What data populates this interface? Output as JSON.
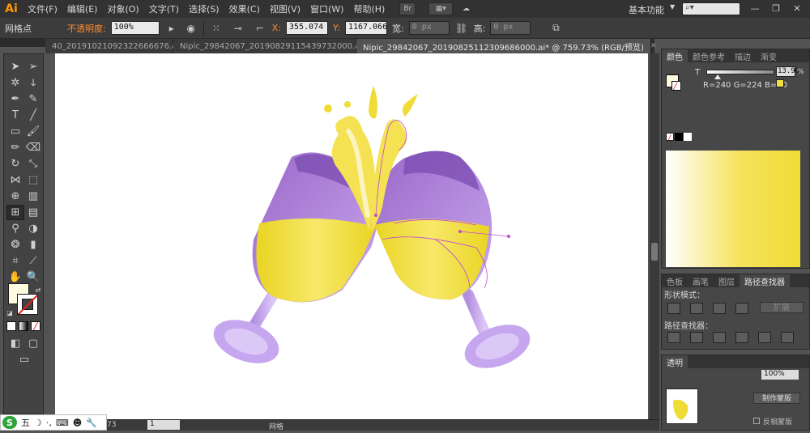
{
  "app": {
    "logo": "Ai"
  },
  "menu": [
    "文件(F)",
    "编辑(E)",
    "对象(O)",
    "文字(T)",
    "选择(S)",
    "效果(C)",
    "视图(V)",
    "窗口(W)",
    "帮助(H)"
  ],
  "menubar": {
    "br_label": "Br",
    "workspace": "基本功能"
  },
  "controlbar": {
    "tool_name": "网格点",
    "opacity_label": "不透明度:",
    "opacity_value": "100%",
    "x_label": "X:",
    "x_value": "355.074 p",
    "y_label": "Y:",
    "y_value": "1167.066",
    "w_label": "宽:",
    "w_value": "0 px",
    "h_label": "高:",
    "h_value": "0 px"
  },
  "tabs": [
    {
      "label": "40_20191021092322666676.ai*",
      "active": false
    },
    {
      "label": "Nipic_29842067_20190829115439732000.ai*",
      "active": false
    },
    {
      "label": "Nipic_29842067_20190825112309686000.ai* @ 759.73% (RGB/预览)",
      "active": true
    }
  ],
  "statusbar": {
    "zoom": "73",
    "page": "1",
    "mode": "网格"
  },
  "ime": {
    "logo": "S",
    "label": "五"
  },
  "color_panel": {
    "tabs": [
      "颜色",
      "颜色参考",
      "描边",
      "渐变"
    ],
    "t_label": "T",
    "tint_value": "13.96",
    "tint_unit": "%",
    "readout": "R=240 G=224 B=70",
    "fill_color": "#fefbe0",
    "base_color": "#f0e046"
  },
  "pathfinder_panel": {
    "tabs": [
      "色板",
      "画笔",
      "图层",
      "路径查找器"
    ],
    "shape_modes_label": "形状模式：",
    "pathfinders_label": "路径查找器：",
    "expand_label": "扩展"
  },
  "transparency_panel": {
    "tabs": [
      "透明"
    ],
    "opacity_value": "100%",
    "make_mask": "制作蒙版",
    "invert_mask": "反相蒙版"
  },
  "artwork": {
    "glass_purple": "#9a68c8",
    "glass_light": "#c8a8f0",
    "juice_yellow": "#f0dc36",
    "juice_light": "#fbf1a8"
  }
}
